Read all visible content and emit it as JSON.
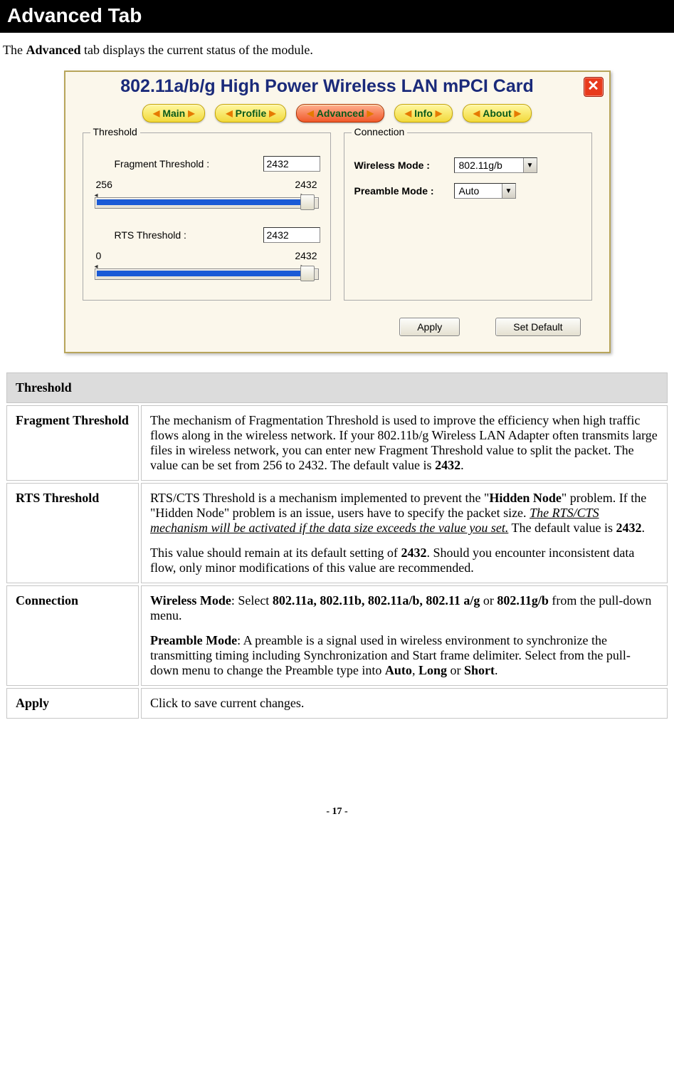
{
  "header": {
    "title": "Advanced Tab"
  },
  "intro": {
    "prefix": "The ",
    "bold": "Advanced",
    "suffix": " tab displays the current status of the module."
  },
  "app": {
    "title": "802.11a/b/g High Power Wireless LAN mPCI Card",
    "close": "✕",
    "tabs": {
      "main": "Main",
      "profile": "Profile",
      "advanced": "Advanced",
      "info": "Info",
      "about": "About"
    },
    "threshold": {
      "legend": "Threshold",
      "frag_label": "Fragment Threshold :",
      "frag_value": "2432",
      "frag_min": "256",
      "frag_max": "2432",
      "rts_label": "RTS Threshold :",
      "rts_value": "2432",
      "rts_min": "0",
      "rts_max": "2432"
    },
    "connection": {
      "legend": "Connection",
      "wmode_label": "Wireless Mode :",
      "wmode_value": "802.11g/b",
      "pmode_label": "Preamble Mode :",
      "pmode_value": "Auto"
    },
    "buttons": {
      "apply": "Apply",
      "setdefault": "Set Default"
    }
  },
  "table": {
    "header": "Threshold",
    "rows": {
      "frag": {
        "label": "Fragment Threshold",
        "p1a": "The mechanism of Fragmentation Threshold is used to improve the efficiency when high traffic flows along in the wireless network. If your 802.11b/g Wireless LAN Adapter often transmits large files in wireless network, you can enter new Fragment Threshold value to split the packet.    The value can be set from 256 to 2432. The default value is ",
        "p1b": "2432",
        "p1c": "."
      },
      "rts": {
        "label": "RTS Threshold",
        "p1a": "RTS/CTS Threshold is a mechanism implemented to prevent the \"",
        "p1b": "Hidden Node",
        "p1c": "\" problem. If the \"Hidden Node\" problem is an issue, users have to specify the packet size. ",
        "p1d": "The RTS/CTS mechanism will be activated if the data size exceeds the value you set.",
        "p1e": " The default value is ",
        "p1f": "2432",
        "p1g": ".",
        "p2a": "This value should remain at its default setting of ",
        "p2b": "2432",
        "p2c": ".    Should you encounter inconsistent data flow, only minor modifications of this value are recommended."
      },
      "conn": {
        "label": "Connection",
        "p1a": "Wireless Mode",
        "p1b": ": Select ",
        "p1c": "802.11a, 802.11b, 802.11a/b, 802.11 a/g",
        "p1d": " or ",
        "p1e": "802.11g/b",
        "p1f": " from the pull-down menu.",
        "p2a": "Preamble Mode",
        "p2b": ": A preamble is a signal used in wireless environment to synchronize the transmitting timing including Synchronization and Start frame delimiter. Select from the pull-down menu to change the Preamble type into ",
        "p2c": "Auto",
        "p2d": ", ",
        "p2e": "Long",
        "p2f": " or ",
        "p2g": "Short",
        "p2h": "."
      },
      "apply": {
        "label": "Apply",
        "desc": "Click to save current changes."
      }
    }
  },
  "footer": {
    "page": "- 17 -"
  }
}
